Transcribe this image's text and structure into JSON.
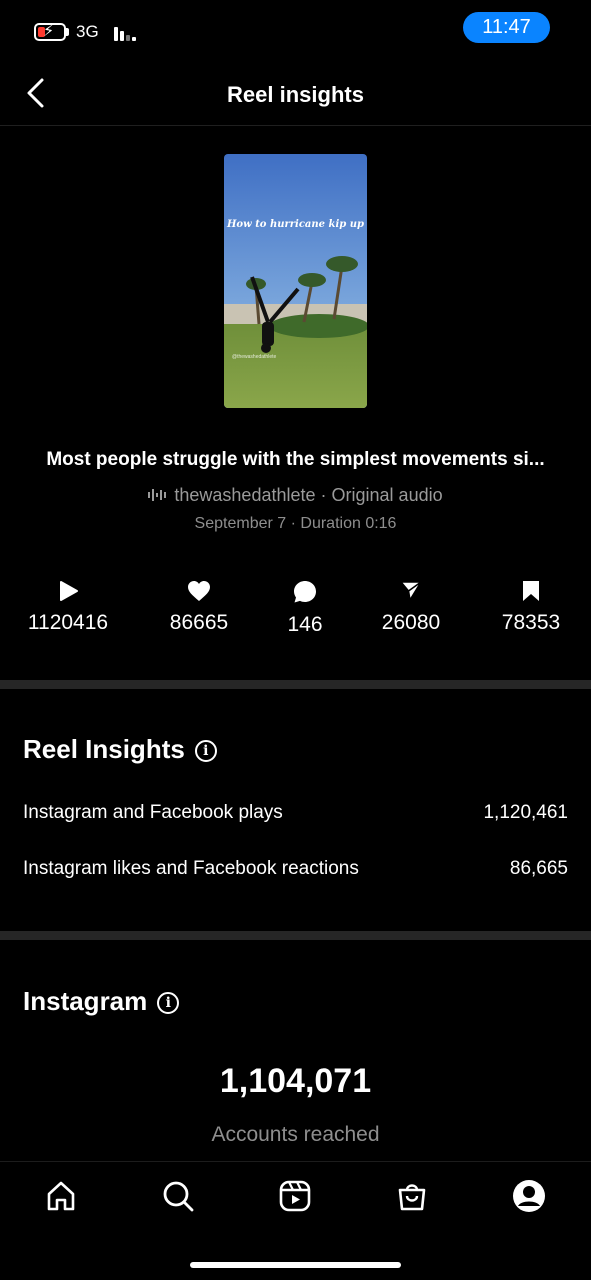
{
  "status_bar": {
    "network": "3G",
    "time": "11:47"
  },
  "header": {
    "title": "Reel insights",
    "back_icon": "chevron-left-icon"
  },
  "reel": {
    "thumbnail_text": "How to hurricane kip up",
    "thumbnail_handle": "@thewashedathlete",
    "caption": "Most people struggle with the simplest movements si...",
    "audio_owner": "thewashedathlete",
    "audio_name": "Original audio",
    "separator": "·",
    "date": "September 7",
    "duration": "Duration 0:16"
  },
  "stats": [
    {
      "icon": "play-icon",
      "value": "1120416"
    },
    {
      "icon": "heart-icon",
      "value": "86665"
    },
    {
      "icon": "comment-icon",
      "value": "146"
    },
    {
      "icon": "send-icon",
      "value": "26080"
    },
    {
      "icon": "bookmark-icon",
      "value": "78353"
    }
  ],
  "reel_insights": {
    "title": "Reel Insights",
    "rows": [
      {
        "label": "Instagram and Facebook plays",
        "value": "1,120,461"
      },
      {
        "label": "Instagram likes and Facebook reactions",
        "value": "86,665"
      }
    ]
  },
  "instagram": {
    "title": "Instagram",
    "accounts_reached": "1,104,071",
    "accounts_reached_label": "Accounts reached"
  },
  "bottom_nav": [
    "home-icon",
    "search-icon",
    "reels-icon",
    "shop-icon",
    "profile-icon"
  ],
  "colors": {
    "accent": "#0a84ff",
    "muted_text": "#8e8e8e",
    "divider": "#262626"
  }
}
